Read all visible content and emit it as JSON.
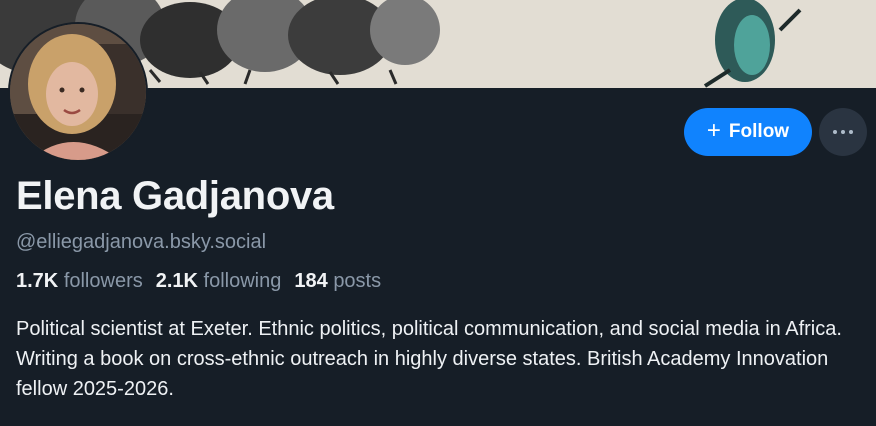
{
  "profile": {
    "display_name": "Elena Gadjanova",
    "handle": "@elliegadjanova.bsky.social",
    "stats": {
      "followers_count": "1.7K",
      "followers_label": "followers",
      "following_count": "2.1K",
      "following_label": "following",
      "posts_count": "184",
      "posts_label": "posts"
    },
    "bio": "Political scientist at Exeter. Ethnic politics, political communication, and social media in Africa. Writing a book on cross-ethnic outreach in highly diverse states. British Academy Innovation fellow 2025-2026."
  },
  "actions": {
    "follow_label": "Follow",
    "follow_icon": "plus-icon",
    "more_icon": "ellipsis-icon"
  },
  "colors": {
    "background": "#161e27",
    "accent": "#1083fe",
    "muted_text": "#8a98a8",
    "secondary_button": "#2a3441"
  }
}
